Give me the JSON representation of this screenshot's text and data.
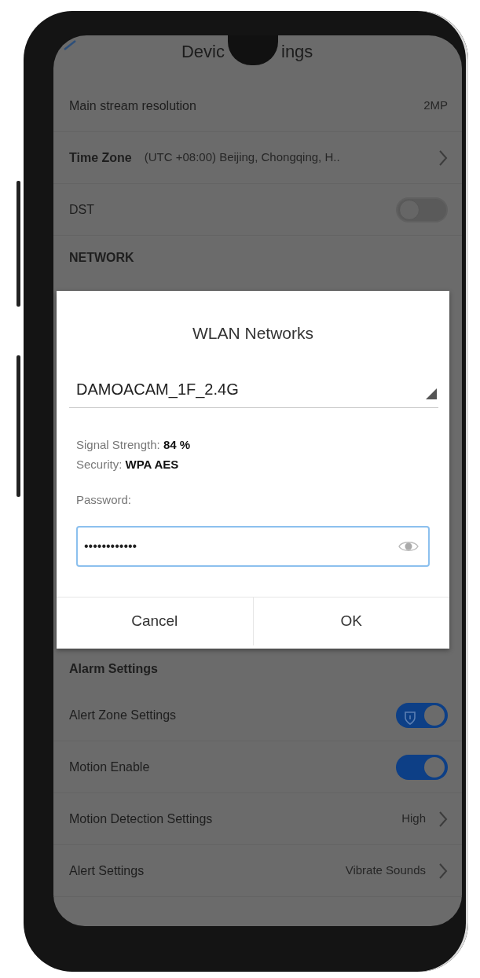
{
  "header": {
    "title_parts": [
      "Devic",
      "ings"
    ]
  },
  "rows_top": [
    {
      "kind": "value",
      "label": "Main stream resolution",
      "value": "2MP"
    },
    {
      "kind": "link",
      "label": "Time Zone",
      "value": "(UTC +08:00) Beijing, Chongqing, H.."
    },
    {
      "kind": "toggle",
      "label": "DST",
      "on": false
    },
    {
      "kind": "section",
      "label": "NETWORK"
    }
  ],
  "dialog": {
    "title": "WLAN Networks",
    "network": "DAMOACAM_1F_2.4G",
    "info": [
      {
        "label": "Signal Strength:",
        "value": "84 %"
      },
      {
        "label": "Security:",
        "value": "WPA AES"
      }
    ],
    "password_label": "Password:",
    "password": "••••••••••••",
    "focused": true,
    "buttons": [
      "Cancel",
      "OK"
    ]
  },
  "rows_bottom": [
    {
      "kind": "section",
      "label": "Alarm Settings"
    },
    {
      "kind": "shield-toggle",
      "label": "Alert Zone Settings",
      "on": true
    },
    {
      "kind": "toggle",
      "label": "Motion Enable",
      "on": true
    },
    {
      "kind": "link",
      "label": "Motion Detection Settings",
      "value": "High"
    },
    {
      "kind": "link",
      "label": "Alert Settings",
      "value": "Vibrate Sounds"
    }
  ]
}
